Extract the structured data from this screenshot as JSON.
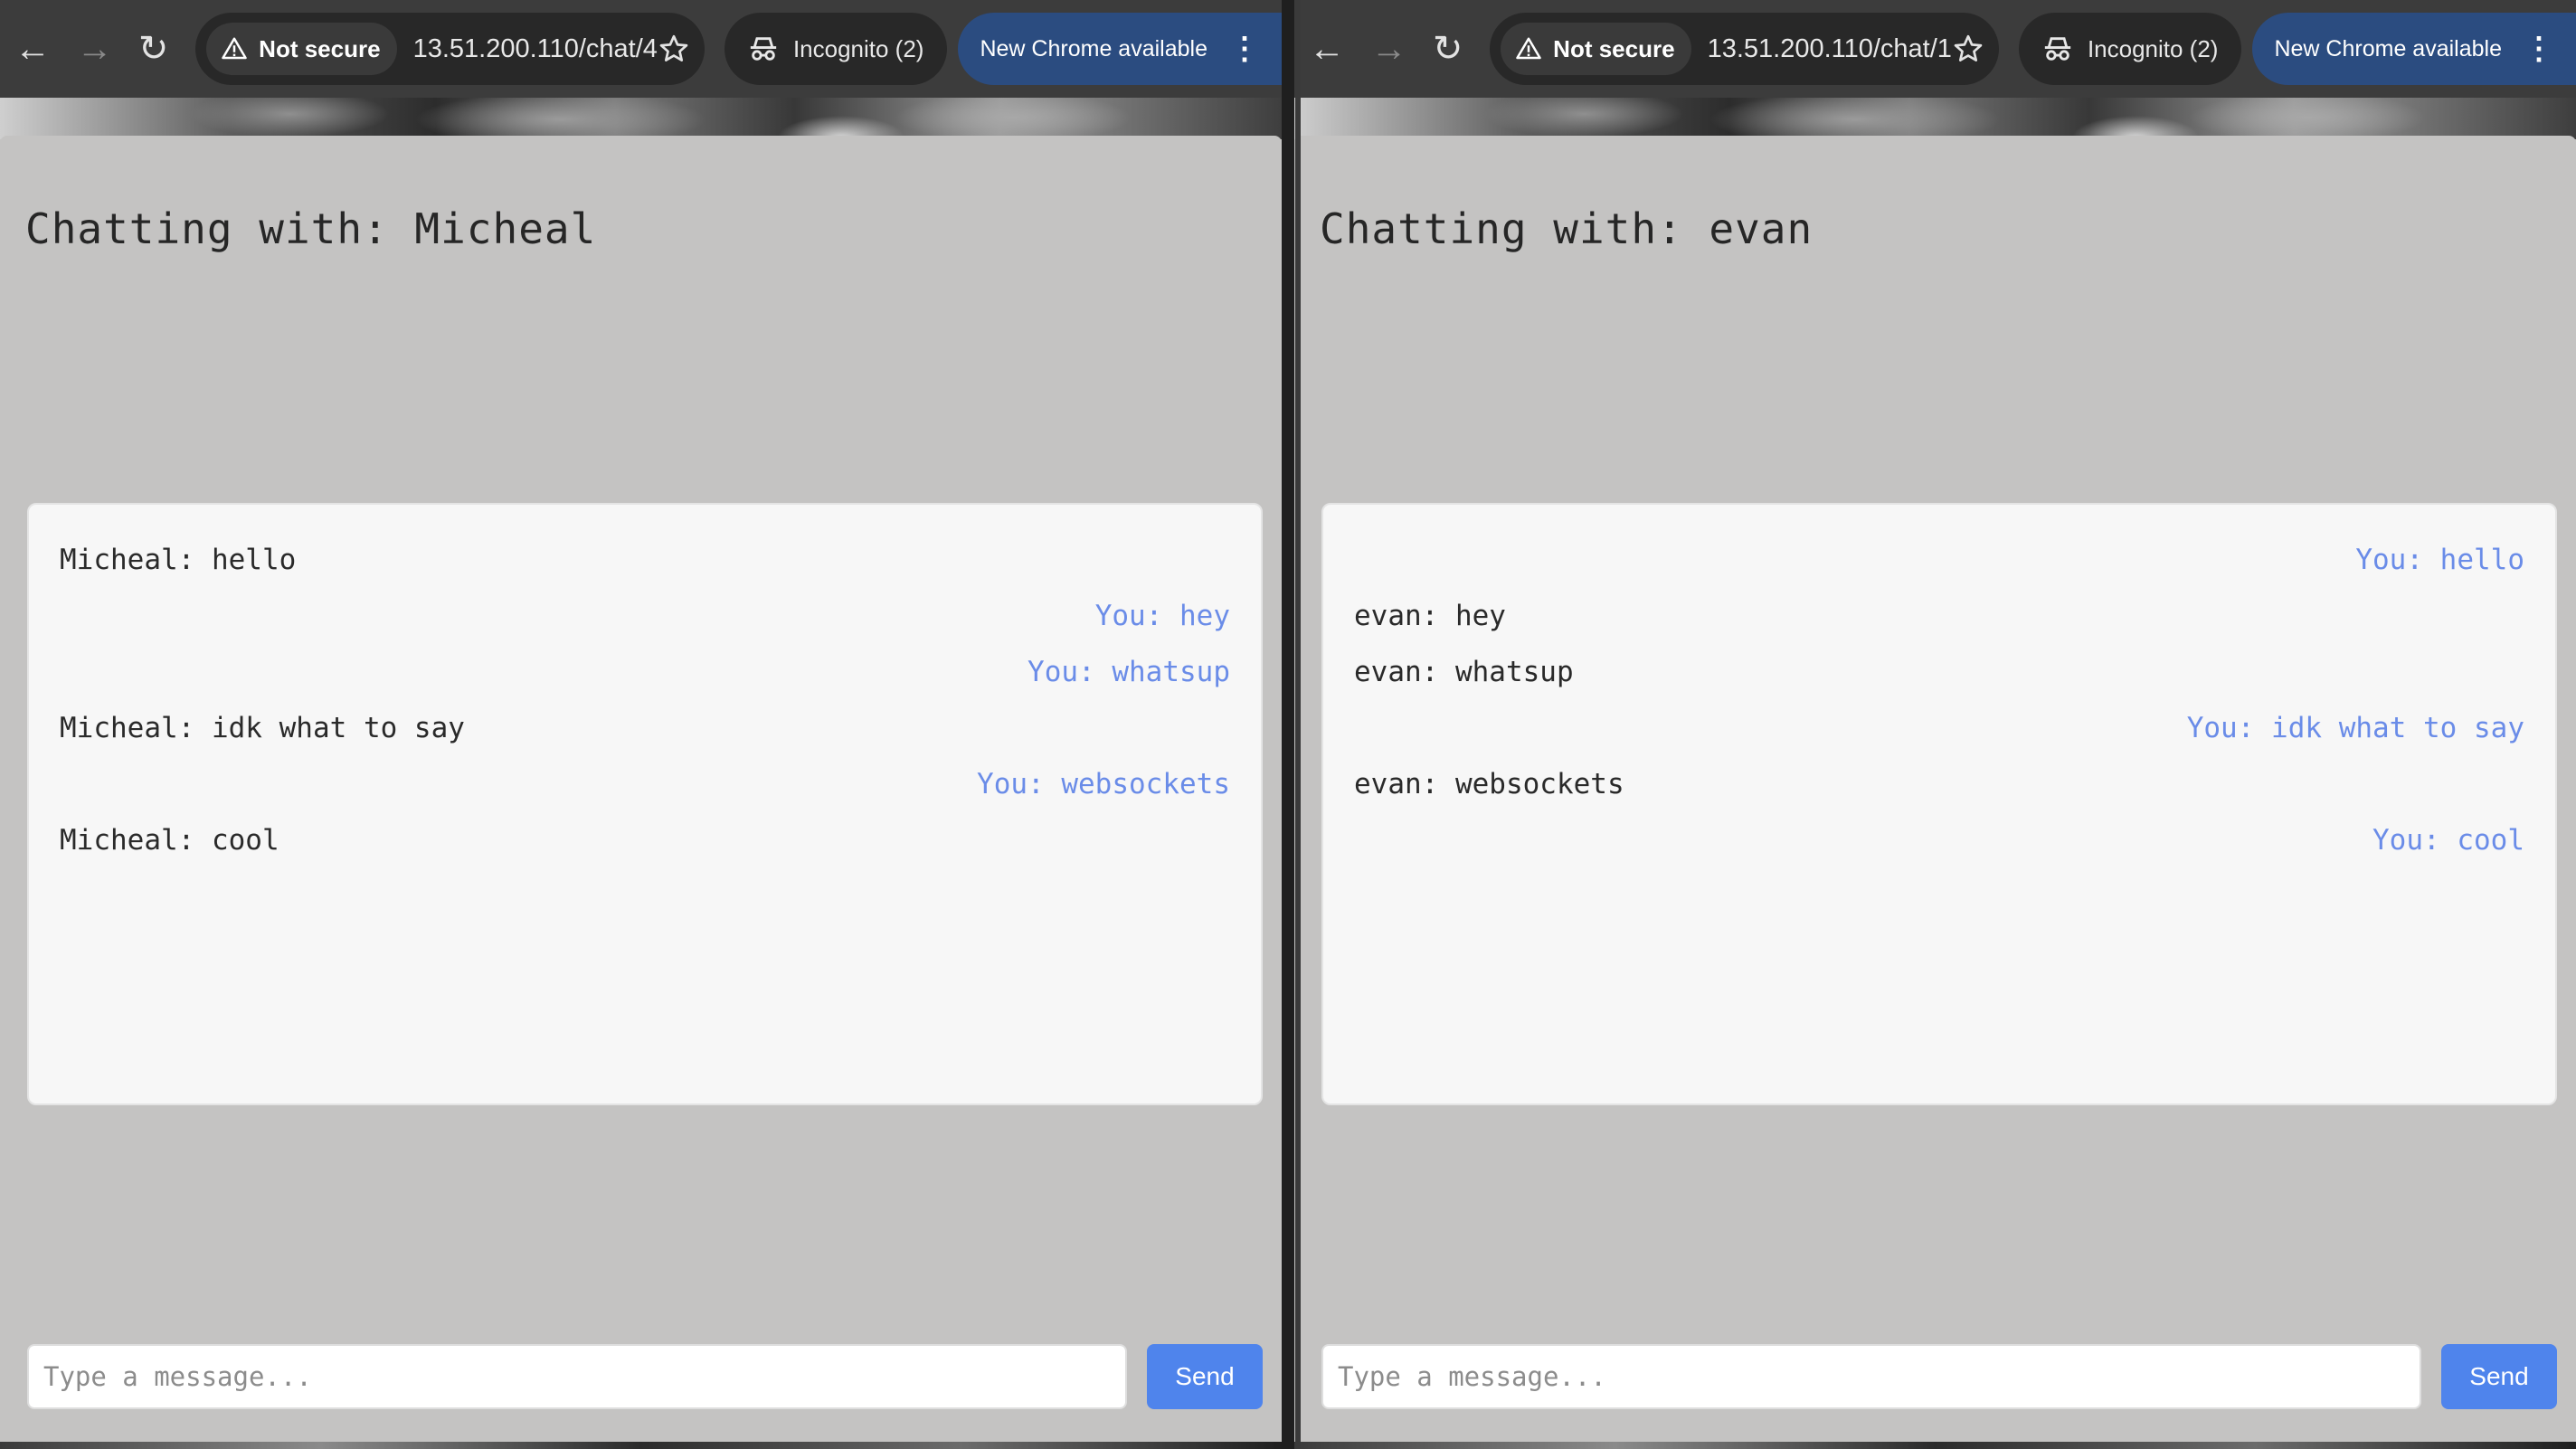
{
  "windows": [
    {
      "toolbar": {
        "security_label": "Not secure",
        "url": "13.51.200.110/chat/4",
        "incognito_label": "Incognito (2)",
        "update_label": "New Chrome available"
      },
      "chat": {
        "title": "Chatting with: Micheal",
        "messages": [
          {
            "sender": "them",
            "text": "Micheal: hello"
          },
          {
            "sender": "you",
            "text": "You: hey"
          },
          {
            "sender": "you",
            "text": "You: whatsup"
          },
          {
            "sender": "them",
            "text": "Micheal: idk what to say"
          },
          {
            "sender": "you",
            "text": "You: websockets"
          },
          {
            "sender": "them",
            "text": "Micheal: cool"
          }
        ],
        "input_placeholder": "Type a message...",
        "send_label": "Send"
      }
    },
    {
      "toolbar": {
        "security_label": "Not secure",
        "url": "13.51.200.110/chat/1",
        "incognito_label": "Incognito (2)",
        "update_label": "New Chrome available"
      },
      "chat": {
        "title": "Chatting with: evan",
        "messages": [
          {
            "sender": "you",
            "text": "You: hello"
          },
          {
            "sender": "them",
            "text": "evan: hey"
          },
          {
            "sender": "them",
            "text": "evan: whatsup"
          },
          {
            "sender": "you",
            "text": "You: idk what to say"
          },
          {
            "sender": "them",
            "text": "evan: websockets"
          },
          {
            "sender": "you",
            "text": "You: cool"
          }
        ],
        "input_placeholder": "Type a message...",
        "send_label": "Send"
      }
    }
  ],
  "colors": {
    "toolbar_bg": "#3c3c3c",
    "page_bg": "#c4c3c2",
    "you_message": "#6a8ce8",
    "them_message": "#2a2a2a",
    "send_button": "#4f84ec",
    "update_chip": "#2b4c80"
  },
  "icons": [
    "back-arrow-icon",
    "forward-arrow-icon",
    "reload-icon",
    "warning-icon",
    "star-icon",
    "incognito-icon",
    "kebab-menu-icon"
  ]
}
